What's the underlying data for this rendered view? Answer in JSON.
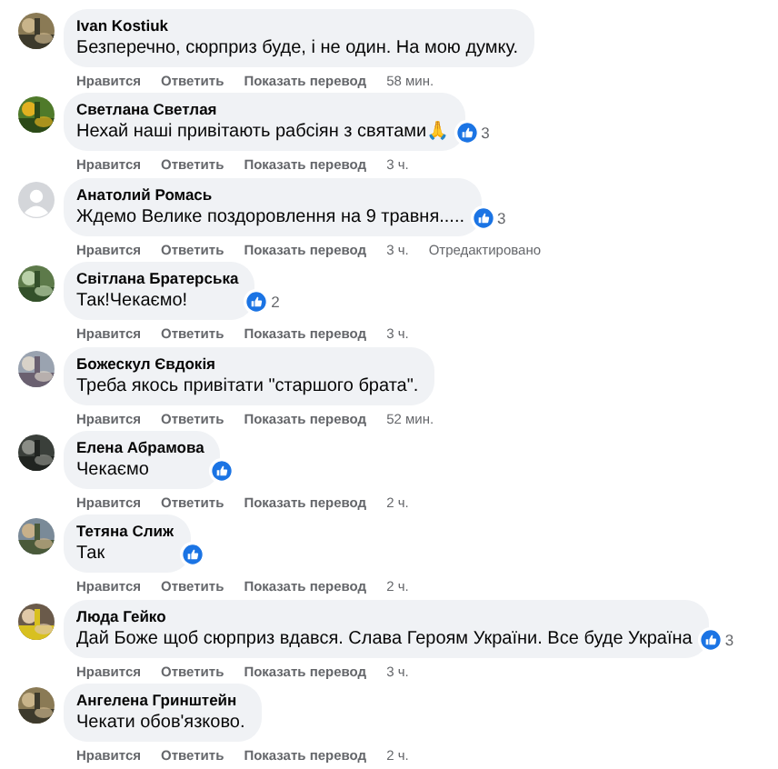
{
  "comments": [
    {
      "author": "Ivan Kostiuk",
      "text": "Безперечно, сюрприз буде, і не один. На мою думку.",
      "has_reaction": false,
      "actions": [
        "Нравится",
        "Ответить",
        "Показать перевод"
      ],
      "time": "58 мин."
    },
    {
      "author": "Светлана Светлая",
      "text": "Нехай наші привітають рабсіян з святами🙏",
      "has_reaction": true,
      "reaction_count": "3",
      "actions": [
        "Нравится",
        "Ответить",
        "Показать перевод"
      ],
      "time": "3 ч."
    },
    {
      "author": "Анатолий Ромась",
      "avatar": {
        "kind": "default"
      },
      "text": "Ждемо Велике поздоровлення на 9 травня.....",
      "has_reaction": true,
      "reaction_count": "3",
      "actions": [
        "Нравится",
        "Ответить",
        "Показать перевод"
      ],
      "time": "3 ч.",
      "edited": "Отредактировано"
    },
    {
      "author": "Світлана Братерська",
      "text": "Так!Чекаємо!",
      "has_reaction": true,
      "reaction_count": "2",
      "actions": [
        "Нравится",
        "Ответить",
        "Показать перевод"
      ],
      "time": "3 ч."
    },
    {
      "author": "Божескул Євдокія",
      "text": "Треба якось привітати \"старшого брата\".",
      "has_reaction": false,
      "actions": [
        "Нравится",
        "Ответить",
        "Показать перевод"
      ],
      "time": "52 мин."
    },
    {
      "author": "Елена Абрамова",
      "text": "Чекаємо",
      "has_reaction": true,
      "actions": [
        "Нравится",
        "Ответить",
        "Показать перевод"
      ],
      "time": "2 ч."
    },
    {
      "author": "Тетяна Слиж",
      "text": "Так",
      "has_reaction": true,
      "actions": [
        "Нравится",
        "Ответить",
        "Показать перевод"
      ],
      "time": "2 ч."
    },
    {
      "author": "Люда Гейко",
      "text": "Дай Боже щоб сюрприз вдався. Слава Героям України. Все буде Україна",
      "has_reaction": true,
      "reaction_count": "3",
      "actions": [
        "Нравится",
        "Ответить",
        "Показать перевод"
      ],
      "time": "3 ч."
    },
    {
      "author": "Ангелена Гринштейн",
      "text": "Чекати обов'язково.",
      "has_reaction": false,
      "actions": [
        "Нравится",
        "Ответить",
        "Показать перевод"
      ],
      "time": "2 ч."
    }
  ]
}
